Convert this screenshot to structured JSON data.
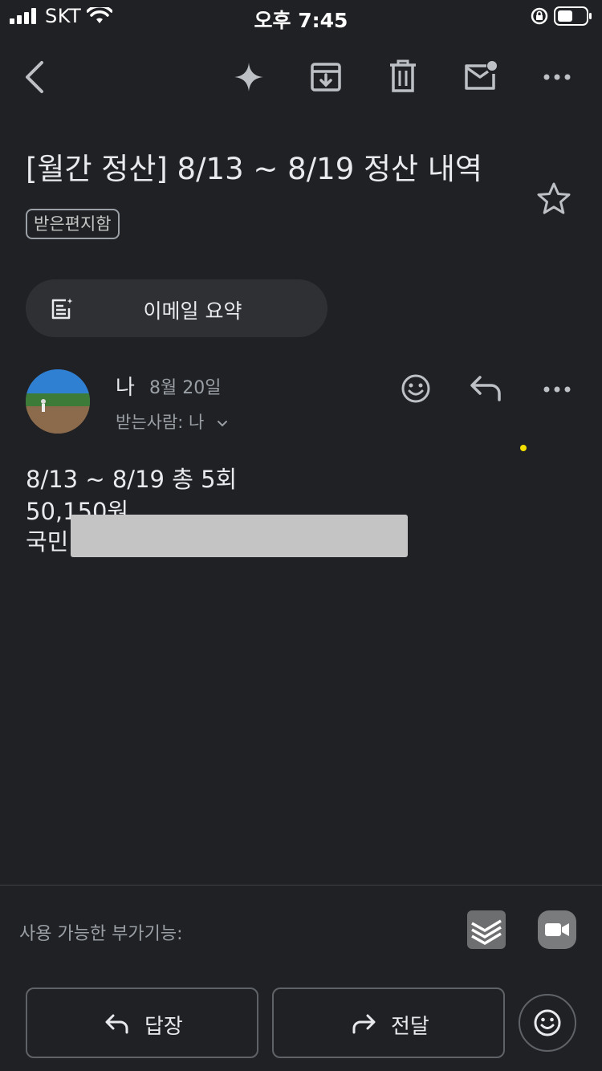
{
  "status_bar": {
    "carrier": "SKT",
    "time": "오후 7:45"
  },
  "toolbar": {
    "icons": [
      "back-icon",
      "sparkle-icon",
      "archive-icon",
      "trash-icon",
      "mark-unread-icon",
      "more-icon"
    ]
  },
  "email": {
    "subject": "[월간 정산] 8/13 ~ 8/19 정산 내역",
    "label": "받은편지함",
    "summary_button": "이메일 요약",
    "sender": "나",
    "date": "8월 20일",
    "recipients": "받는사람: 나",
    "body": {
      "line1": "8/13 ~ 8/19 총 5회",
      "line2": "50,150원",
      "line3": "국민"
    }
  },
  "footer": {
    "addons_label": "사용 가능한 부가기능:",
    "reply_label": "답장",
    "forward_label": "전달"
  },
  "colors": {
    "background": "#202124",
    "text": "#e8eaed",
    "secondary": "#9aa0a6",
    "summary_bg": "#2f3033",
    "accent_dot": "#f4e000"
  }
}
